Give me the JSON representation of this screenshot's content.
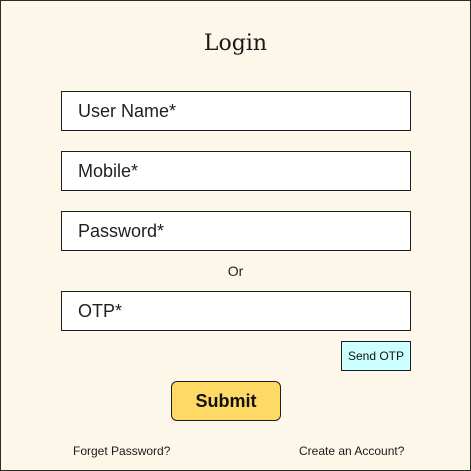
{
  "form": {
    "title": "Login",
    "fields": {
      "username_placeholder": "User Name*",
      "mobile_placeholder": "Mobile*",
      "password_placeholder": "Password*",
      "otp_placeholder": "OTP*"
    },
    "or_text": "Or",
    "send_otp_label": "Send OTP",
    "submit_label": "Submit",
    "links": {
      "forget_password": "Forget Password?",
      "create_account": "Create an Account?"
    }
  },
  "colors": {
    "background": "#fdf7ea",
    "submit_button": "#ffd966",
    "send_otp_button": "#ccffff",
    "border": "#1f1f1f"
  }
}
